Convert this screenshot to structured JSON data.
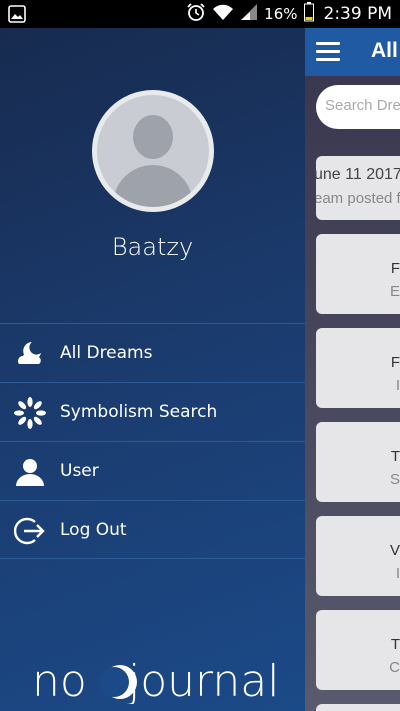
{
  "status_bar": {
    "battery": "16%",
    "time": "2:39 PM",
    "icons": [
      "image-icon",
      "alarm-icon",
      "wifi-icon",
      "signal-icon",
      "battery-icon"
    ]
  },
  "app": {
    "title": "All",
    "search_placeholder": "Search Dre",
    "first_card": {
      "line1": "une 11 2017",
      "line2": "eam posted fo"
    },
    "cards": [
      {
        "line1": "F",
        "line2": "E"
      },
      {
        "line1": "F",
        "line2": "I"
      },
      {
        "line1": "T",
        "line2": "S"
      },
      {
        "line1": "V",
        "line2": "I"
      },
      {
        "line1": "T",
        "line2": "C"
      }
    ]
  },
  "drawer": {
    "username": "Baatzy",
    "menu": [
      {
        "label": "All Dreams",
        "icon": "moon-cloud-icon"
      },
      {
        "label": "Symbolism Search",
        "icon": "flower-icon"
      },
      {
        "label": "User",
        "icon": "user-icon"
      },
      {
        "label": "Log Out",
        "icon": "logout-icon"
      }
    ],
    "logo": "nojournal"
  },
  "colors": {
    "drawer_top": "#172b4f",
    "drawer_bottom": "#1b4a88",
    "app_bar": "#1f5aa3",
    "divider": "#2b5a94"
  }
}
